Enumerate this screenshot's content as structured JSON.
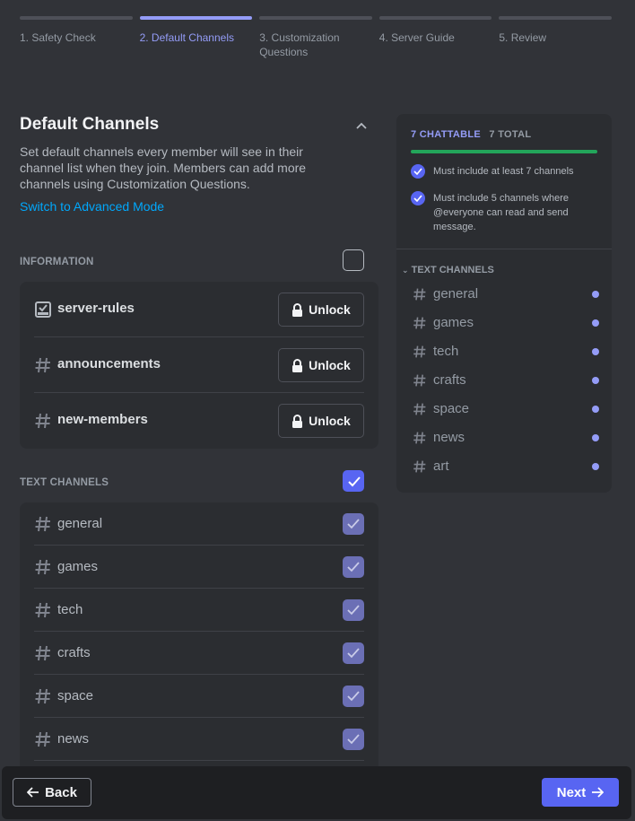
{
  "stepper": [
    {
      "label": "1. Safety Check",
      "active": false
    },
    {
      "label": "2. Default Channels",
      "active": true
    },
    {
      "label": "3. Customization Questions",
      "active": false
    },
    {
      "label": "4. Server Guide",
      "active": false
    },
    {
      "label": "5. Review",
      "active": false
    }
  ],
  "main": {
    "title": "Default Channels",
    "description": "Set default channels every member will see in their channel list when they join. Members can add more channels using Customization Questions.",
    "advanced_link": "Switch to Advanced Mode"
  },
  "information": {
    "label": "INFORMATION",
    "checked": false,
    "unlock_label": "Unlock",
    "channels": [
      {
        "name": "server-rules",
        "icon": "rules-icon"
      },
      {
        "name": "announcements",
        "icon": "hashtag-icon"
      },
      {
        "name": "new-members",
        "icon": "hashtag-icon"
      }
    ]
  },
  "text_channels": {
    "label": "TEXT CHANNELS",
    "checked": true,
    "channels": [
      "general",
      "games",
      "tech",
      "crafts",
      "space",
      "news"
    ]
  },
  "panel": {
    "chattable": "7 CHATTABLE",
    "total": "7 TOTAL",
    "progress": 1.0,
    "requirements": [
      "Must include at least 7 channels",
      "Must include 5 channels where @everyone can read and send message."
    ],
    "category": "TEXT CHANNELS",
    "channels": [
      "general",
      "games",
      "tech",
      "crafts",
      "space",
      "news",
      "art"
    ]
  },
  "footer": {
    "back_label": "Back",
    "next_label": "Next"
  },
  "colors": {
    "accent": "#5865f2",
    "accent_light": "#949cf7",
    "progress": "#23a55a",
    "background": "#313338"
  }
}
